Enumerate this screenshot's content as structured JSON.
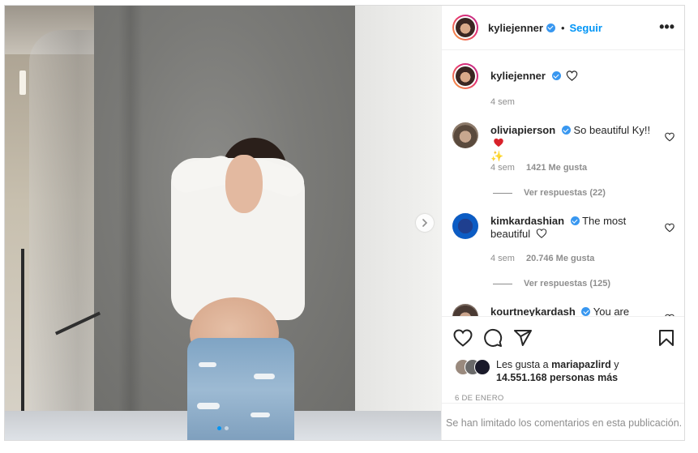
{
  "post": {
    "author": "kyliejenner",
    "follow_label": "Seguir",
    "separator": "•",
    "more_label": "•••",
    "caption_author": "kyliejenner",
    "caption_time": "4 sem",
    "photo_index": 1,
    "photo_count": 2
  },
  "comments": [
    {
      "user": "oliviapierson",
      "text": "So beautiful Ky!!",
      "emoji": "✨",
      "time": "4 sem",
      "likes": "1421 Me gusta",
      "replies": "Ver respuestas (22)"
    },
    {
      "user": "kimkardashian",
      "text": "The most beautiful",
      "time": "4 sem",
      "likes": "20.746 Me gusta",
      "replies": "Ver respuestas (125)"
    },
    {
      "user": "kourtneykardash",
      "text": "You are"
    }
  ],
  "likes": {
    "prefix": "Les gusta a",
    "user": "mariapazlird",
    "connector": "y",
    "count": "14.551.168 personas más"
  },
  "date": "6 DE ENERO",
  "comments_disabled": "Se han limitado los comentarios en esta publicación.",
  "colors": {
    "accent": "#0095f6",
    "verified": "#3897f0",
    "heart_red": "#ed4956"
  },
  "icons": [
    "heart-icon",
    "comment-icon",
    "share-icon",
    "save-icon",
    "more-icon",
    "verified-icon",
    "chevron-right-icon"
  ]
}
